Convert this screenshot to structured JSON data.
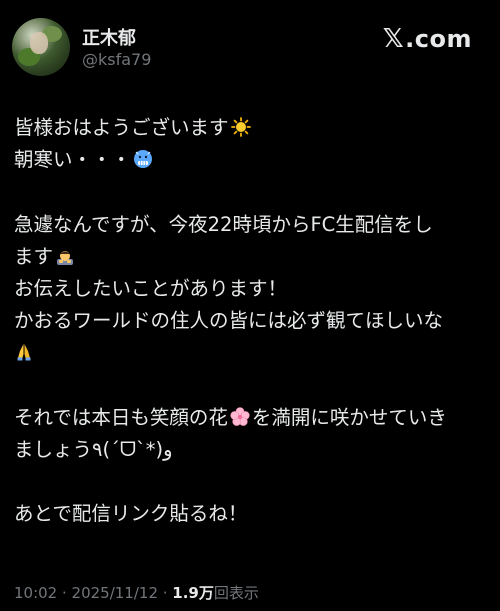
{
  "author": {
    "name": "正木郁",
    "handle": "@ksfa79"
  },
  "brand": {
    "x_mark": "𝕏",
    "domain": ".com"
  },
  "post": {
    "line1": "皆様おはようございます",
    "line2": "朝寒い・・・",
    "line3": "急遽なんですが、今夜22時頃からFC生配信をし",
    "line4": "ます",
    "line5": "お伝えしたいことがあります！",
    "line6": "かおるワールドの住人の皆には必ず観てほしいな",
    "line8": "それでは本日も笑顔の花",
    "line8b": "を満開に咲かせていき",
    "line9": "ましょう٩(´ᗜ`*)و",
    "line11": "あとで配信リンク貼るね！"
  },
  "footer": {
    "time_date": "10:02 · 2025/11/12 · ",
    "views_count": "1.9万",
    "views_label": "回表示"
  },
  "icons": {
    "sun": "sun-emoji",
    "cold_face": "cold-face-emoji",
    "bowing": "bowing-person-emoji",
    "folded_hands": "folded-hands-emoji",
    "cherry_blossom": "cherry-blossom-emoji"
  }
}
